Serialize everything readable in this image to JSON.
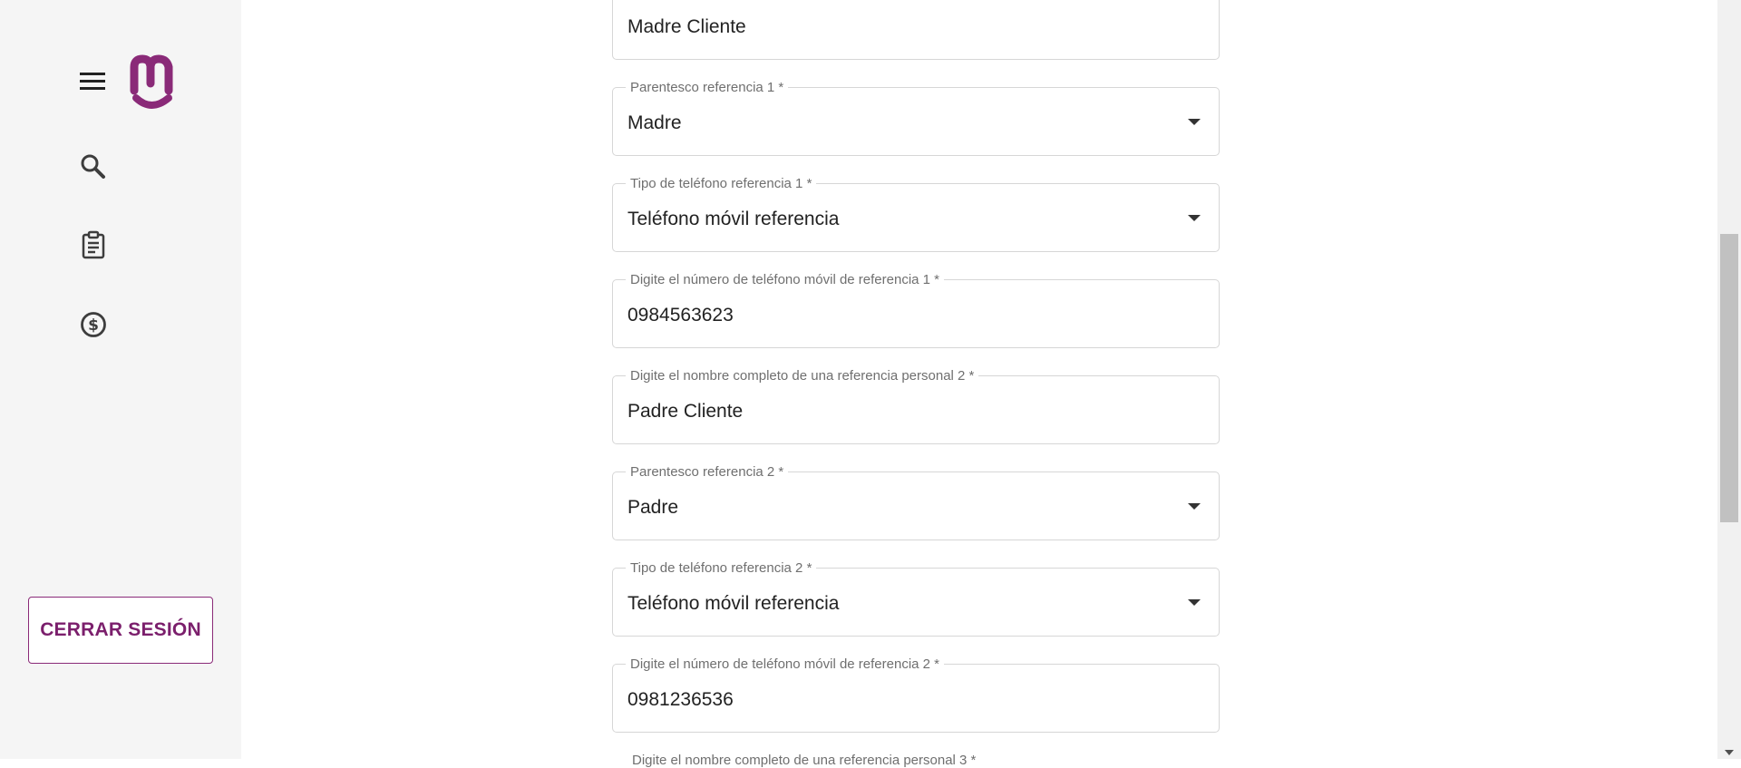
{
  "sidebar": {
    "menu_icon": "hamburger-menu-icon",
    "logo_icon": "m-smile-logo",
    "nav_icons": [
      "search-icon",
      "clipboard-icon",
      "dollar-circle-icon"
    ],
    "logout_label": "CERRAR SESIÓN",
    "brand_color": "#8a2a78"
  },
  "form": {
    "fields": [
      {
        "label": "",
        "value": "Madre Cliente",
        "type": "text"
      },
      {
        "label": "Parentesco referencia 1 *",
        "value": "Madre",
        "type": "select"
      },
      {
        "label": "Tipo de teléfono referencia 1 *",
        "value": "Teléfono móvil referencia",
        "type": "select"
      },
      {
        "label": "Digite el número de teléfono móvil de referencia 1 *",
        "value": "0984563623",
        "type": "text"
      },
      {
        "label": "Digite el nombre completo de una referencia personal 2 *",
        "value": "Padre Cliente",
        "type": "text"
      },
      {
        "label": "Parentesco referencia 2 *",
        "value": "Padre",
        "type": "select"
      },
      {
        "label": "Tipo de teléfono referencia 2 *",
        "value": "Teléfono móvil referencia",
        "type": "select"
      },
      {
        "label": "Digite el número de teléfono móvil de referencia 2 *",
        "value": "0981236536",
        "type": "text"
      }
    ]
  }
}
